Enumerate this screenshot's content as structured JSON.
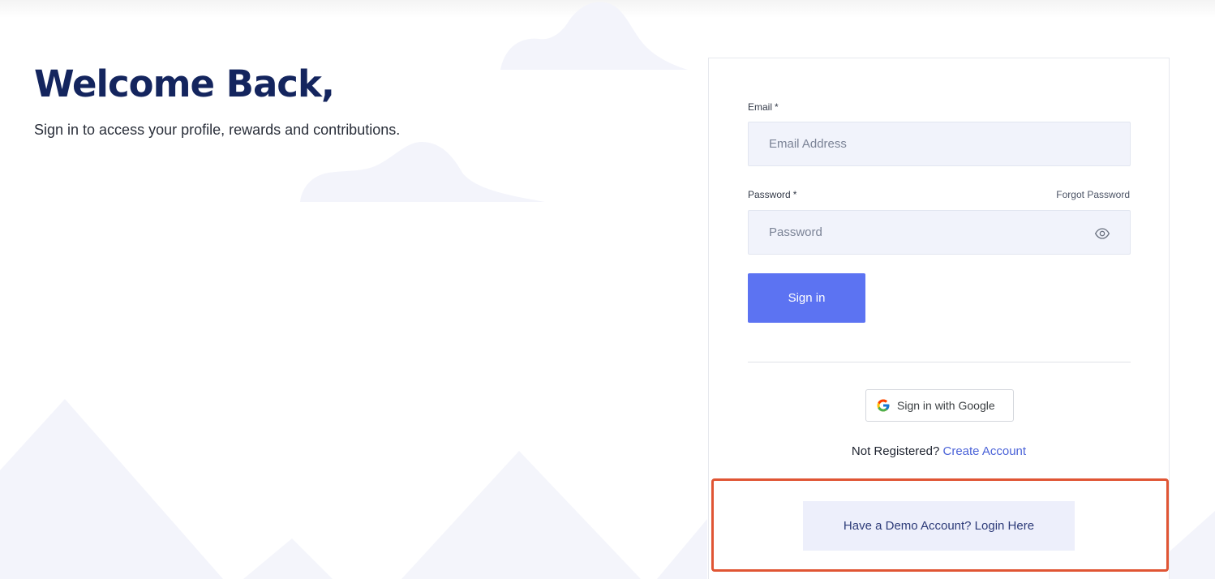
{
  "hero": {
    "title": "Welcome Back,",
    "subtitle": "Sign in to access your profile, rewards and contributions."
  },
  "form": {
    "email_label": "Email",
    "email_required_mark": "*",
    "email_placeholder": "Email Address",
    "password_label": "Password",
    "password_required_mark": "*",
    "password_placeholder": "Password",
    "forgot_password": "Forgot Password",
    "password_toggle_icon": "eye-icon",
    "signin_label": "Sign in"
  },
  "social": {
    "google_label": "Sign in with Google",
    "google_icon": "google-logo-icon"
  },
  "register": {
    "prompt": "Not Registered?",
    "link": "Create Account"
  },
  "demo": {
    "label": "Have a Demo Account? Login Here"
  },
  "colors": {
    "brand_navy": "#14255e",
    "primary_button": "#5c73f2",
    "link": "#4b63d8",
    "highlight_outline": "#e05534",
    "demo_button_bg": "#edeffb",
    "input_bg": "#f1f3fb"
  }
}
